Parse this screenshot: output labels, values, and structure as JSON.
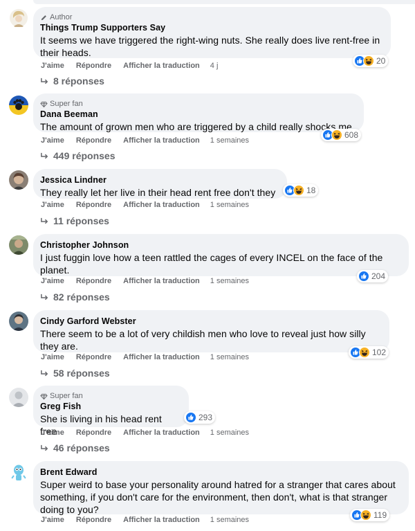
{
  "actions": {
    "like": "J'aime",
    "reply": "Répondre",
    "translate": "Afficher la traduction"
  },
  "comments": [
    {
      "badge": "Author",
      "badge_icon": "pencil-icon",
      "name": "Things Trump Supporters Say",
      "text": "It seems we have triggered the right-wing nuts. She really does live rent-free in their heads.",
      "reaction_icons": [
        "like-icon",
        "haha-icon"
      ],
      "reactions": "20",
      "time": "4 j",
      "replies": "8 réponses"
    },
    {
      "badge": "Super fan",
      "badge_icon": "diamond-icon",
      "name": "Dana Beeman",
      "text": "The amount of grown men who are triggered by a child really shocks me.",
      "reaction_icons": [
        "like-icon",
        "haha-icon"
      ],
      "reactions": "608",
      "time": "1 semaines",
      "replies": "449 réponses"
    },
    {
      "badge": "",
      "name": "Jessica Lindner",
      "text": "They really let her live in their head rent free don't they",
      "reaction_icons": [
        "like-icon",
        "haha-icon"
      ],
      "reactions": "18",
      "time": "1 semaines",
      "replies": "11 réponses"
    },
    {
      "badge": "",
      "name": "Christopher Johnson",
      "text": "I just fuggin love how a teen rattled the cages of every INCEL on the face of the planet.",
      "reaction_icons": [
        "like-icon"
      ],
      "reactions": "204",
      "time": "1 semaines",
      "replies": "82 réponses"
    },
    {
      "badge": "",
      "name": "Cindy Garford Webster",
      "text": "There seem to be a lot of very childish men who love to reveal just how silly they are.",
      "reaction_icons": [
        "like-icon",
        "haha-icon"
      ],
      "reactions": "102",
      "time": "1 semaines",
      "replies": "58 réponses"
    },
    {
      "badge": "Super fan",
      "badge_icon": "diamond-icon",
      "name": "Greg Fish",
      "text": "She is living in his head rent free",
      "reaction_icons": [
        "like-icon"
      ],
      "reactions": "293",
      "time": "1 semaines",
      "replies": "46 réponses"
    },
    {
      "badge": "",
      "name": "Brent Edward",
      "text": "Super weird to base your personality around hatred for a stranger that cares about something, if you don't care for the environment, then don't, what is that stranger doing to you?",
      "reaction_icons": [
        "like-icon",
        "haha-icon"
      ],
      "reactions": "119",
      "time": "1 semaines",
      "replies": ""
    }
  ],
  "colors": {
    "like": "#1877f2",
    "haha": "#f7b125",
    "bubble": "#f0f2f5",
    "secondary_text": "#65676b"
  }
}
